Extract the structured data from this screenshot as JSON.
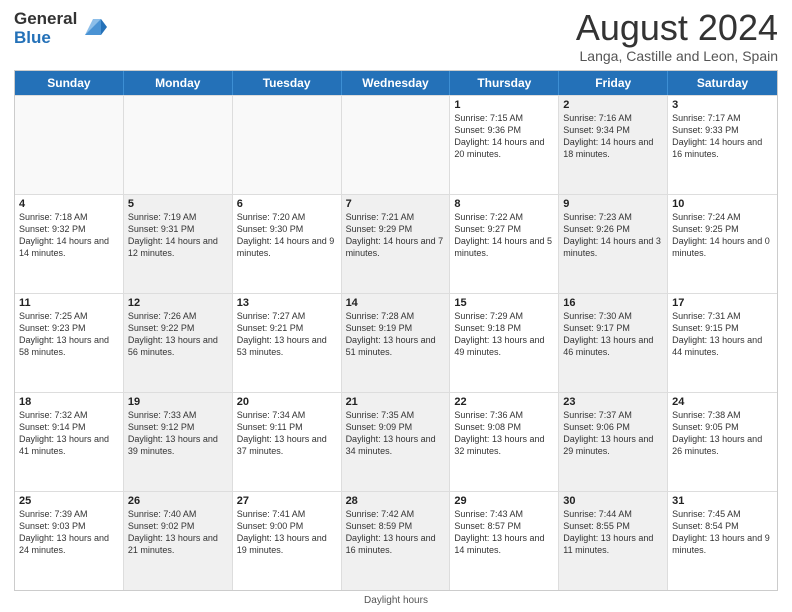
{
  "logo": {
    "text_general": "General",
    "text_blue": "Blue"
  },
  "header": {
    "month": "August 2024",
    "location": "Langa, Castille and Leon, Spain"
  },
  "days_of_week": [
    "Sunday",
    "Monday",
    "Tuesday",
    "Wednesday",
    "Thursday",
    "Friday",
    "Saturday"
  ],
  "footer": {
    "label": "Daylight hours"
  },
  "weeks": [
    [
      {
        "day": "",
        "text": "",
        "empty": true
      },
      {
        "day": "",
        "text": "",
        "empty": true
      },
      {
        "day": "",
        "text": "",
        "empty": true
      },
      {
        "day": "",
        "text": "",
        "empty": true
      },
      {
        "day": "1",
        "text": "Sunrise: 7:15 AM\nSunset: 9:36 PM\nDaylight: 14 hours and 20 minutes.",
        "empty": false
      },
      {
        "day": "2",
        "text": "Sunrise: 7:16 AM\nSunset: 9:34 PM\nDaylight: 14 hours and 18 minutes.",
        "empty": false,
        "shaded": true
      },
      {
        "day": "3",
        "text": "Sunrise: 7:17 AM\nSunset: 9:33 PM\nDaylight: 14 hours and 16 minutes.",
        "empty": false
      }
    ],
    [
      {
        "day": "4",
        "text": "Sunrise: 7:18 AM\nSunset: 9:32 PM\nDaylight: 14 hours and 14 minutes.",
        "empty": false
      },
      {
        "day": "5",
        "text": "Sunrise: 7:19 AM\nSunset: 9:31 PM\nDaylight: 14 hours and 12 minutes.",
        "empty": false,
        "shaded": true
      },
      {
        "day": "6",
        "text": "Sunrise: 7:20 AM\nSunset: 9:30 PM\nDaylight: 14 hours and 9 minutes.",
        "empty": false
      },
      {
        "day": "7",
        "text": "Sunrise: 7:21 AM\nSunset: 9:29 PM\nDaylight: 14 hours and 7 minutes.",
        "empty": false,
        "shaded": true
      },
      {
        "day": "8",
        "text": "Sunrise: 7:22 AM\nSunset: 9:27 PM\nDaylight: 14 hours and 5 minutes.",
        "empty": false
      },
      {
        "day": "9",
        "text": "Sunrise: 7:23 AM\nSunset: 9:26 PM\nDaylight: 14 hours and 3 minutes.",
        "empty": false,
        "shaded": true
      },
      {
        "day": "10",
        "text": "Sunrise: 7:24 AM\nSunset: 9:25 PM\nDaylight: 14 hours and 0 minutes.",
        "empty": false
      }
    ],
    [
      {
        "day": "11",
        "text": "Sunrise: 7:25 AM\nSunset: 9:23 PM\nDaylight: 13 hours and 58 minutes.",
        "empty": false
      },
      {
        "day": "12",
        "text": "Sunrise: 7:26 AM\nSunset: 9:22 PM\nDaylight: 13 hours and 56 minutes.",
        "empty": false,
        "shaded": true
      },
      {
        "day": "13",
        "text": "Sunrise: 7:27 AM\nSunset: 9:21 PM\nDaylight: 13 hours and 53 minutes.",
        "empty": false
      },
      {
        "day": "14",
        "text": "Sunrise: 7:28 AM\nSunset: 9:19 PM\nDaylight: 13 hours and 51 minutes.",
        "empty": false,
        "shaded": true
      },
      {
        "day": "15",
        "text": "Sunrise: 7:29 AM\nSunset: 9:18 PM\nDaylight: 13 hours and 49 minutes.",
        "empty": false
      },
      {
        "day": "16",
        "text": "Sunrise: 7:30 AM\nSunset: 9:17 PM\nDaylight: 13 hours and 46 minutes.",
        "empty": false,
        "shaded": true
      },
      {
        "day": "17",
        "text": "Sunrise: 7:31 AM\nSunset: 9:15 PM\nDaylight: 13 hours and 44 minutes.",
        "empty": false
      }
    ],
    [
      {
        "day": "18",
        "text": "Sunrise: 7:32 AM\nSunset: 9:14 PM\nDaylight: 13 hours and 41 minutes.",
        "empty": false
      },
      {
        "day": "19",
        "text": "Sunrise: 7:33 AM\nSunset: 9:12 PM\nDaylight: 13 hours and 39 minutes.",
        "empty": false,
        "shaded": true
      },
      {
        "day": "20",
        "text": "Sunrise: 7:34 AM\nSunset: 9:11 PM\nDaylight: 13 hours and 37 minutes.",
        "empty": false
      },
      {
        "day": "21",
        "text": "Sunrise: 7:35 AM\nSunset: 9:09 PM\nDaylight: 13 hours and 34 minutes.",
        "empty": false,
        "shaded": true
      },
      {
        "day": "22",
        "text": "Sunrise: 7:36 AM\nSunset: 9:08 PM\nDaylight: 13 hours and 32 minutes.",
        "empty": false
      },
      {
        "day": "23",
        "text": "Sunrise: 7:37 AM\nSunset: 9:06 PM\nDaylight: 13 hours and 29 minutes.",
        "empty": false,
        "shaded": true
      },
      {
        "day": "24",
        "text": "Sunrise: 7:38 AM\nSunset: 9:05 PM\nDaylight: 13 hours and 26 minutes.",
        "empty": false
      }
    ],
    [
      {
        "day": "25",
        "text": "Sunrise: 7:39 AM\nSunset: 9:03 PM\nDaylight: 13 hours and 24 minutes.",
        "empty": false
      },
      {
        "day": "26",
        "text": "Sunrise: 7:40 AM\nSunset: 9:02 PM\nDaylight: 13 hours and 21 minutes.",
        "empty": false,
        "shaded": true
      },
      {
        "day": "27",
        "text": "Sunrise: 7:41 AM\nSunset: 9:00 PM\nDaylight: 13 hours and 19 minutes.",
        "empty": false
      },
      {
        "day": "28",
        "text": "Sunrise: 7:42 AM\nSunset: 8:59 PM\nDaylight: 13 hours and 16 minutes.",
        "empty": false,
        "shaded": true
      },
      {
        "day": "29",
        "text": "Sunrise: 7:43 AM\nSunset: 8:57 PM\nDaylight: 13 hours and 14 minutes.",
        "empty": false
      },
      {
        "day": "30",
        "text": "Sunrise: 7:44 AM\nSunset: 8:55 PM\nDaylight: 13 hours and 11 minutes.",
        "empty": false,
        "shaded": true
      },
      {
        "day": "31",
        "text": "Sunrise: 7:45 AM\nSunset: 8:54 PM\nDaylight: 13 hours and 9 minutes.",
        "empty": false
      }
    ]
  ]
}
